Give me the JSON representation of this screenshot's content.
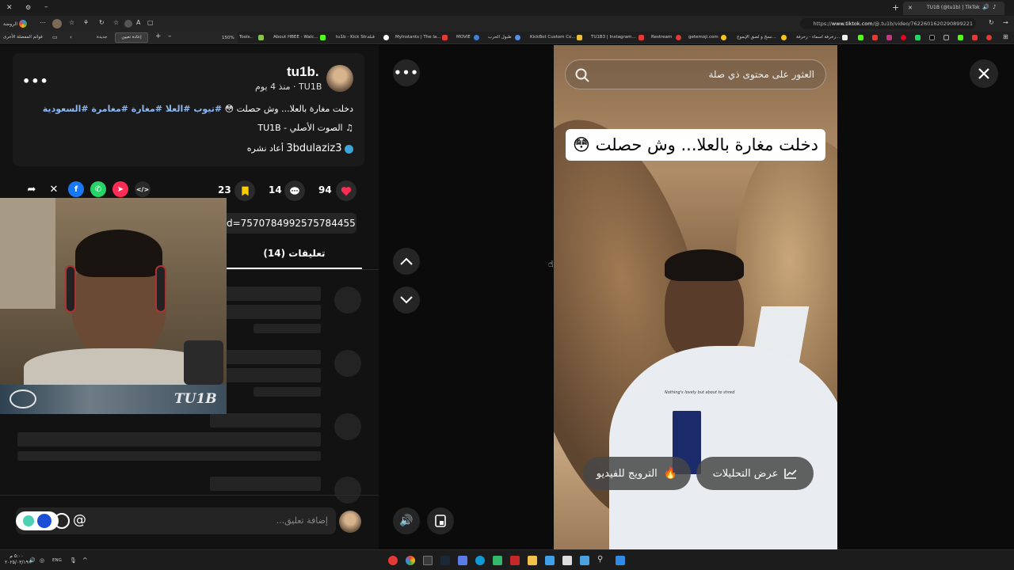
{
  "browser": {
    "tab_title": "TU1B (@tu1b) | TikTok",
    "url_prefix": "https://",
    "url_host": "www.tiktok.com",
    "url_path": "/@.tu1b/video/7622601620290899221",
    "zoom": "150%",
    "reset_zoom": "إعادة تعيين",
    "home_label": "الروضة",
    "other_favorites": "قوائم المفضلة الأخرى",
    "new_label": "جديدة",
    "bookmarks": [
      "Tools..",
      "About HBEE - Walc...",
      "tu1b - Kick Str...",
      "قناة",
      "MyInstants | The la...",
      "MOVIE",
      "طبول الحرب",
      "KickBot Custom Co...",
      "TU1B3 | Instagram...",
      "Restream",
      "getemoji.com",
      "نسخ و لصق الإيموج...",
      "زخرفة اسماء - زخرفة..."
    ]
  },
  "post": {
    "username": "tu1b.",
    "nickname": "TU1B",
    "time_ago": "منذ 4 يوم",
    "caption": "دخلت مغارة بالعلا... وش حصلت 😳",
    "hashtags": "#تيوب #العلا #مغارة #مغامرة #السعودية",
    "sound": "الصوت الأصلي - TU1B",
    "reposted_by": "3bdulaziz3",
    "reposted_text": "أعاد نشره",
    "likes": "94",
    "comments": "14",
    "saves": "23",
    "link_text": "d=7570784992575784455",
    "comments_tab": "تعليقات (14)",
    "comment_placeholder": "إضافة تعليق...",
    "at_symbol": "@"
  },
  "overlay": {
    "streamer_name": "TU1B"
  },
  "video": {
    "search_placeholder": "العثور على محتوى ذي صلة",
    "caption_overlay": "دخلت مغارة بالعلا... وش حصلت 😳",
    "analytics_label": "عرض التحليلات",
    "promote_label": "الترويج للفيديو",
    "shirt_text": "Nothing's lovely but about to shred"
  },
  "taskbar": {
    "time": "٥:٠٠ م",
    "date": "٢٠٢٥/٠٣/١٩",
    "lang": "ENG"
  },
  "colors": {
    "like": "#fe2c55",
    "save": "#facd00",
    "hashtag": "#8fb8f0",
    "bg": "#121212"
  }
}
